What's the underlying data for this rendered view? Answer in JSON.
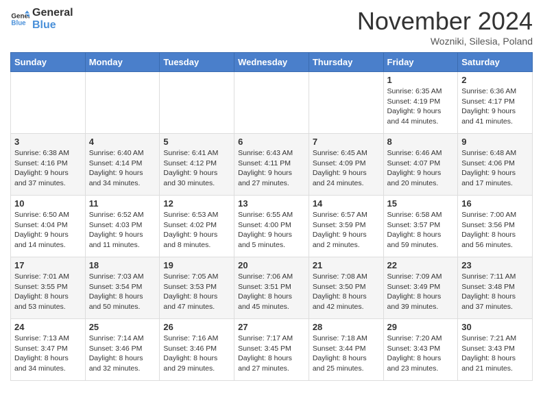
{
  "header": {
    "logo_line1": "General",
    "logo_line2": "Blue",
    "month": "November 2024",
    "location": "Wozniki, Silesia, Poland"
  },
  "days_of_week": [
    "Sunday",
    "Monday",
    "Tuesday",
    "Wednesday",
    "Thursday",
    "Friday",
    "Saturday"
  ],
  "weeks": [
    [
      {
        "day": "",
        "info": ""
      },
      {
        "day": "",
        "info": ""
      },
      {
        "day": "",
        "info": ""
      },
      {
        "day": "",
        "info": ""
      },
      {
        "day": "",
        "info": ""
      },
      {
        "day": "1",
        "info": "Sunrise: 6:35 AM\nSunset: 4:19 PM\nDaylight: 9 hours\nand 44 minutes."
      },
      {
        "day": "2",
        "info": "Sunrise: 6:36 AM\nSunset: 4:17 PM\nDaylight: 9 hours\nand 41 minutes."
      }
    ],
    [
      {
        "day": "3",
        "info": "Sunrise: 6:38 AM\nSunset: 4:16 PM\nDaylight: 9 hours\nand 37 minutes."
      },
      {
        "day": "4",
        "info": "Sunrise: 6:40 AM\nSunset: 4:14 PM\nDaylight: 9 hours\nand 34 minutes."
      },
      {
        "day": "5",
        "info": "Sunrise: 6:41 AM\nSunset: 4:12 PM\nDaylight: 9 hours\nand 30 minutes."
      },
      {
        "day": "6",
        "info": "Sunrise: 6:43 AM\nSunset: 4:11 PM\nDaylight: 9 hours\nand 27 minutes."
      },
      {
        "day": "7",
        "info": "Sunrise: 6:45 AM\nSunset: 4:09 PM\nDaylight: 9 hours\nand 24 minutes."
      },
      {
        "day": "8",
        "info": "Sunrise: 6:46 AM\nSunset: 4:07 PM\nDaylight: 9 hours\nand 20 minutes."
      },
      {
        "day": "9",
        "info": "Sunrise: 6:48 AM\nSunset: 4:06 PM\nDaylight: 9 hours\nand 17 minutes."
      }
    ],
    [
      {
        "day": "10",
        "info": "Sunrise: 6:50 AM\nSunset: 4:04 PM\nDaylight: 9 hours\nand 14 minutes."
      },
      {
        "day": "11",
        "info": "Sunrise: 6:52 AM\nSunset: 4:03 PM\nDaylight: 9 hours\nand 11 minutes."
      },
      {
        "day": "12",
        "info": "Sunrise: 6:53 AM\nSunset: 4:02 PM\nDaylight: 9 hours\nand 8 minutes."
      },
      {
        "day": "13",
        "info": "Sunrise: 6:55 AM\nSunset: 4:00 PM\nDaylight: 9 hours\nand 5 minutes."
      },
      {
        "day": "14",
        "info": "Sunrise: 6:57 AM\nSunset: 3:59 PM\nDaylight: 9 hours\nand 2 minutes."
      },
      {
        "day": "15",
        "info": "Sunrise: 6:58 AM\nSunset: 3:57 PM\nDaylight: 8 hours\nand 59 minutes."
      },
      {
        "day": "16",
        "info": "Sunrise: 7:00 AM\nSunset: 3:56 PM\nDaylight: 8 hours\nand 56 minutes."
      }
    ],
    [
      {
        "day": "17",
        "info": "Sunrise: 7:01 AM\nSunset: 3:55 PM\nDaylight: 8 hours\nand 53 minutes."
      },
      {
        "day": "18",
        "info": "Sunrise: 7:03 AM\nSunset: 3:54 PM\nDaylight: 8 hours\nand 50 minutes."
      },
      {
        "day": "19",
        "info": "Sunrise: 7:05 AM\nSunset: 3:53 PM\nDaylight: 8 hours\nand 47 minutes."
      },
      {
        "day": "20",
        "info": "Sunrise: 7:06 AM\nSunset: 3:51 PM\nDaylight: 8 hours\nand 45 minutes."
      },
      {
        "day": "21",
        "info": "Sunrise: 7:08 AM\nSunset: 3:50 PM\nDaylight: 8 hours\nand 42 minutes."
      },
      {
        "day": "22",
        "info": "Sunrise: 7:09 AM\nSunset: 3:49 PM\nDaylight: 8 hours\nand 39 minutes."
      },
      {
        "day": "23",
        "info": "Sunrise: 7:11 AM\nSunset: 3:48 PM\nDaylight: 8 hours\nand 37 minutes."
      }
    ],
    [
      {
        "day": "24",
        "info": "Sunrise: 7:13 AM\nSunset: 3:47 PM\nDaylight: 8 hours\nand 34 minutes."
      },
      {
        "day": "25",
        "info": "Sunrise: 7:14 AM\nSunset: 3:46 PM\nDaylight: 8 hours\nand 32 minutes."
      },
      {
        "day": "26",
        "info": "Sunrise: 7:16 AM\nSunset: 3:46 PM\nDaylight: 8 hours\nand 29 minutes."
      },
      {
        "day": "27",
        "info": "Sunrise: 7:17 AM\nSunset: 3:45 PM\nDaylight: 8 hours\nand 27 minutes."
      },
      {
        "day": "28",
        "info": "Sunrise: 7:18 AM\nSunset: 3:44 PM\nDaylight: 8 hours\nand 25 minutes."
      },
      {
        "day": "29",
        "info": "Sunrise: 7:20 AM\nSunset: 3:43 PM\nDaylight: 8 hours\nand 23 minutes."
      },
      {
        "day": "30",
        "info": "Sunrise: 7:21 AM\nSunset: 3:43 PM\nDaylight: 8 hours\nand 21 minutes."
      }
    ]
  ]
}
